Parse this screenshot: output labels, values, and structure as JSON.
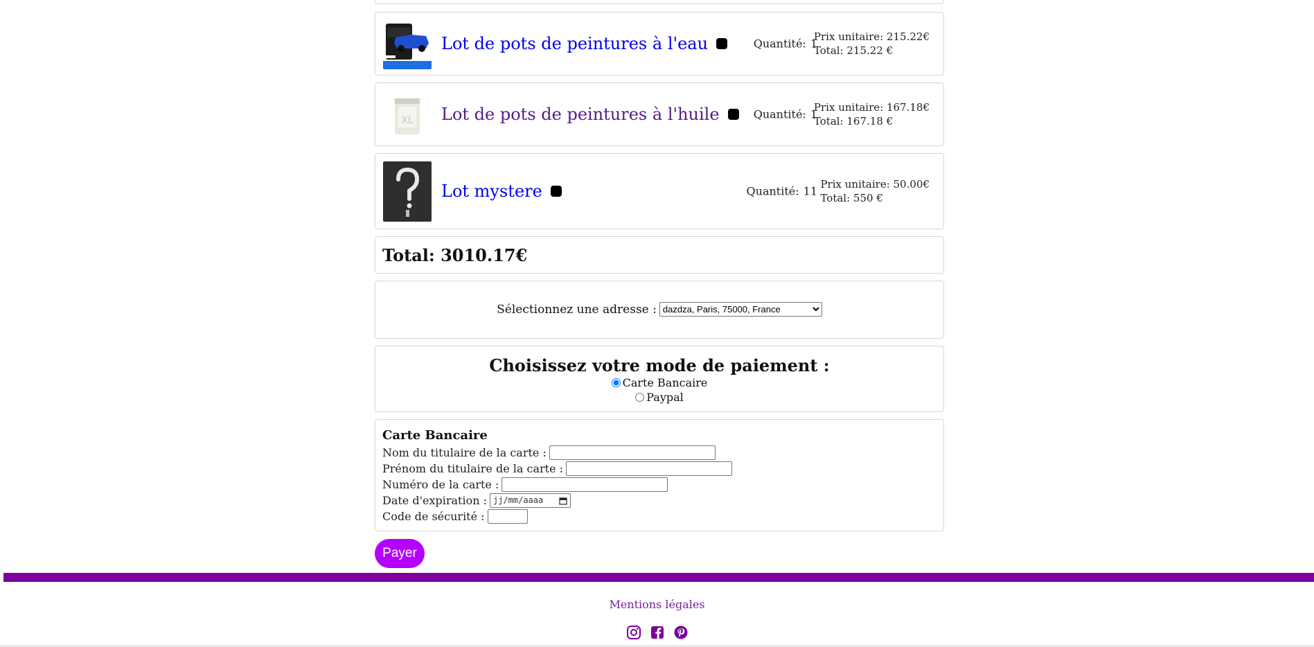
{
  "cart": {
    "items": [
      {
        "name": "Lot de pots de peintures à l'eau",
        "qty_label": "Quantité:",
        "qty": "1",
        "unit_price": "Prix unitaire: 215.22€",
        "total": "Total: 215.22 €",
        "image": "blue-car-paint-can"
      },
      {
        "name": "Lot de pots de peintures à l'huile",
        "qty_label": "Quantité:",
        "qty": "1",
        "unit_price": "Prix unitaire: 167.18€",
        "total": "Total: 167.18 €",
        "image": "white-paint-can"
      },
      {
        "name": "Lot mystere",
        "qty_label": "Quantité:",
        "qty": "11",
        "unit_price": "Prix unitaire: 50.00€",
        "total": "Total: 550 €",
        "image": "question-mark-figure"
      }
    ],
    "grand_total": "Total: 3010.17€"
  },
  "address": {
    "label": "Sélectionnez une adresse :",
    "selected": "dazdza, Paris, 75000, France"
  },
  "payment": {
    "title": "Choisissez votre mode de paiement :",
    "options": [
      {
        "label": "Carte Bancaire",
        "checked": true
      },
      {
        "label": "Paypal",
        "checked": false
      }
    ]
  },
  "card_form": {
    "title": "Carte Bancaire",
    "holder_name_label": "Nom du titulaire de la carte :",
    "holder_firstname_label": "Prénom du titulaire de la carte :",
    "card_number_label": "Numéro de la carte :",
    "expiry_label": "Date d'expiration :",
    "expiry_placeholder": "jj/mm/aaaa",
    "security_code_label": "Code de sécurité :"
  },
  "pay_button": "Payer",
  "footer": {
    "legal_link": "Mentions légales",
    "social_icons": [
      "instagram-icon",
      "facebook-icon",
      "pinterest-icon"
    ],
    "accent": "#7b009d"
  },
  "colors": {
    "button": "#b400ff",
    "link": "#0000ee",
    "link_visited": "#551a8b"
  }
}
